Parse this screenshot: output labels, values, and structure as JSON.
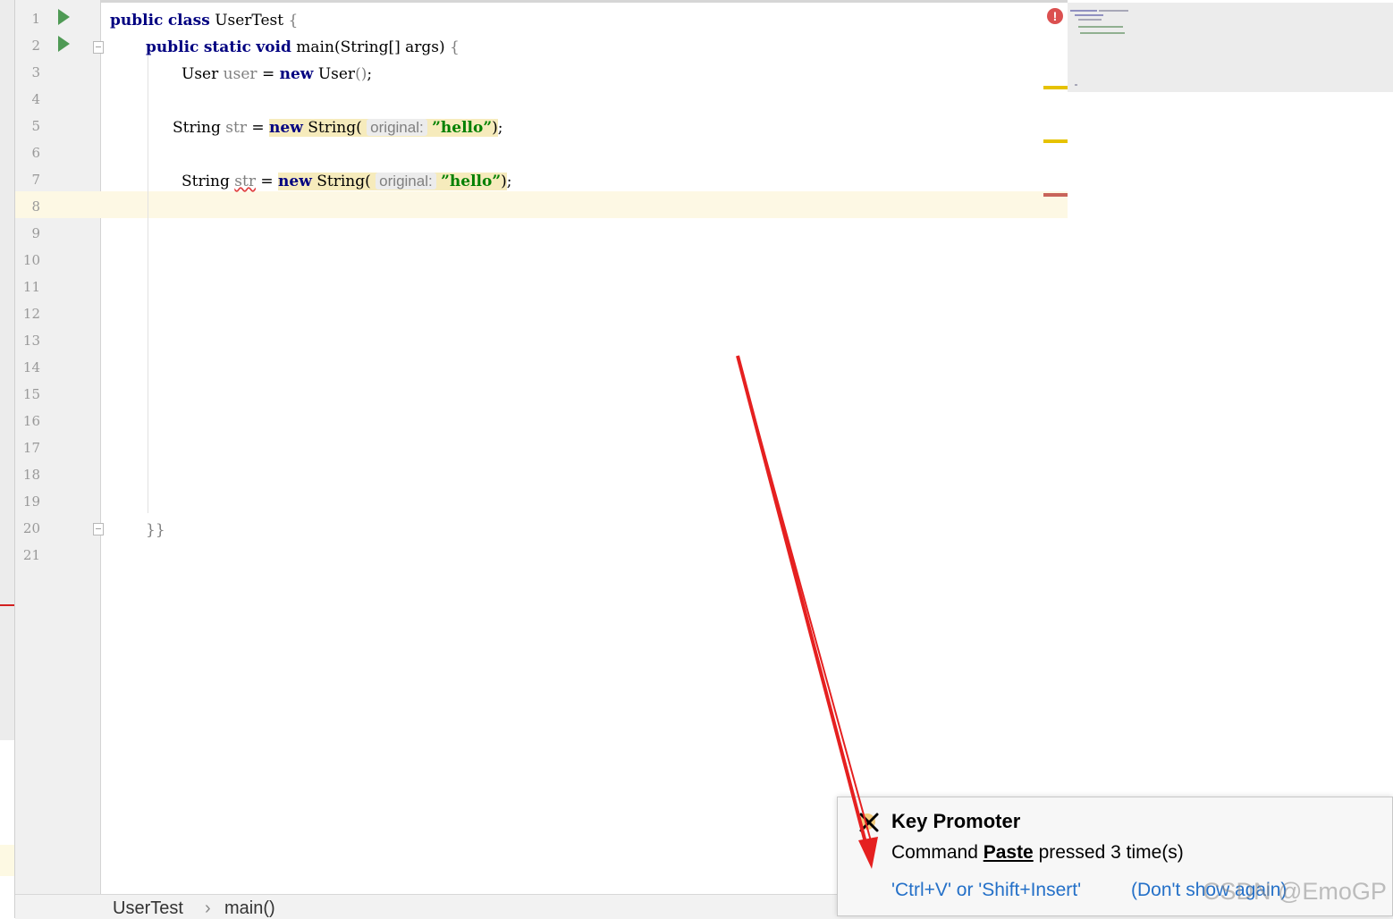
{
  "editor": {
    "line_numbers": [
      "1",
      "2",
      "3",
      "4",
      "5",
      "6",
      "7",
      "8",
      "9",
      "10",
      "11",
      "12",
      "13",
      "14",
      "15",
      "16",
      "17",
      "18",
      "19",
      "20",
      "21"
    ],
    "lines": {
      "l1": {
        "kw1": "public",
        "kw2": "class",
        "name": "UserTest",
        "brace": "{"
      },
      "l2": {
        "kw1": "public",
        "kw2": "static",
        "kw3": "void",
        "name": "main",
        "params": "(String[] args)",
        "brace": "{"
      },
      "l3": {
        "type": "User",
        "var": "user",
        "op": "=",
        "kw": "new",
        "ctor": "User",
        "parens": "()",
        "semi": ";"
      },
      "l5": {
        "type": "String",
        "var": "str",
        "op": "=",
        "kw": "new",
        "ctor": "String",
        "open": "(",
        "hint": "original:",
        "str": "”hello”",
        "close": ")",
        "semi": ";"
      },
      "l7": {
        "type": "String",
        "var": "str",
        "op": "=",
        "kw": "new",
        "ctor": "String",
        "open": "(",
        "hint": "original:",
        "str": "”hello”",
        "close": ")",
        "semi": ";"
      },
      "l20": {
        "text": "}}"
      }
    }
  },
  "breadcrumb": {
    "class": "UserTest",
    "sep": "›",
    "method": "main()"
  },
  "popup": {
    "title": "Key Promoter",
    "msg_prefix": "Command ",
    "command": "Paste",
    "msg_suffix": " pressed 3 time(s)",
    "shortcut_link": "'Ctrl+V' or 'Shift+Insert'",
    "dismiss_link": "(Don't show again)"
  },
  "watermark": "CSDN @EmoGP",
  "colors": {
    "keyword": "#000080",
    "string": "#008000",
    "run_icon": "#4f9a55",
    "error": "#db5050",
    "warning_marker": "#e6c200",
    "error_marker": "#c8645a",
    "link": "#2470c8",
    "annotation_arrow": "#e52020"
  }
}
